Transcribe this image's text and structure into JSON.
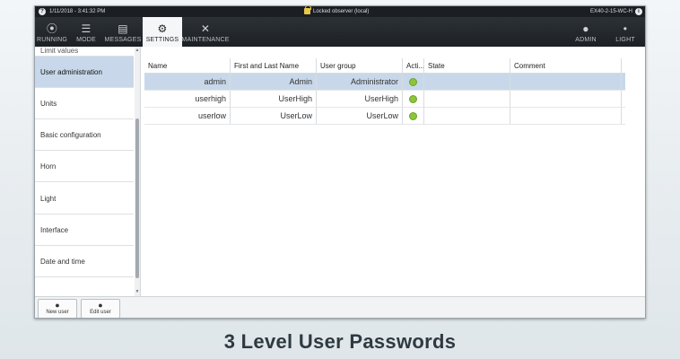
{
  "status": {
    "datetime": "1/11/2018 - 3:41:32 PM",
    "lock_text": "Locked observer (local)",
    "device": "EX40-2-15-WC-H"
  },
  "nav": {
    "items": [
      {
        "label": "RUNNING",
        "icon": "running-icon",
        "glyph": "⦿"
      },
      {
        "label": "MODE",
        "icon": "mode-sliders-icon",
        "glyph": "☰"
      },
      {
        "label": "MESSAGES",
        "icon": "messages-icon",
        "glyph": "▤"
      },
      {
        "label": "SETTINGS",
        "icon": "gear-icon",
        "glyph": "⚙"
      },
      {
        "label": "MAINTENANCE",
        "icon": "tools-icon",
        "glyph": "✕"
      }
    ],
    "right": [
      {
        "label": "ADMIN",
        "icon": "user-icon",
        "glyph": "👤"
      },
      {
        "label": "LIGHT",
        "icon": "light-bulb-icon",
        "glyph": "💡"
      }
    ]
  },
  "sidebar": {
    "items": [
      {
        "label": "Limit values",
        "partial": true
      },
      {
        "label": "User administration",
        "selected": true
      },
      {
        "label": "Units"
      },
      {
        "label": "Basic configuration"
      },
      {
        "label": "Horn"
      },
      {
        "label": "Light"
      },
      {
        "label": "Interface"
      },
      {
        "label": "Date and time"
      }
    ]
  },
  "table": {
    "headers": [
      "Name",
      "First and Last Name",
      "User group",
      "Acti...",
      "State",
      "Comment"
    ],
    "rows": [
      {
        "name": "admin",
        "full": "Admin",
        "group": "Administrator",
        "active": true,
        "state": "",
        "comment": "",
        "selected": true
      },
      {
        "name": "userhigh",
        "full": "UserHigh",
        "group": "UserHigh",
        "active": true,
        "state": "",
        "comment": ""
      },
      {
        "name": "userlow",
        "full": "UserLow",
        "group": "UserLow",
        "active": true,
        "state": "",
        "comment": ""
      }
    ]
  },
  "bottom": {
    "new_user": "New user",
    "edit_user": "Edit user"
  },
  "caption": "3 Level User Passwords",
  "colors": {
    "accent_selected": "#c8d8ea",
    "active_dot": "#8cc43a",
    "nav_bg": "#1d2125"
  }
}
